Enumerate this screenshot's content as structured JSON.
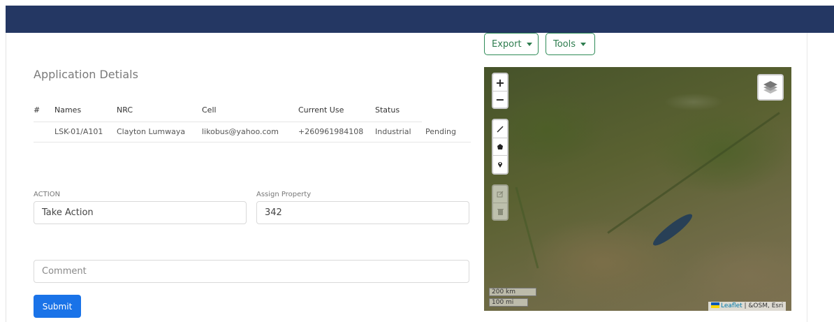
{
  "toolbar": {
    "export_label": "Export",
    "tools_label": "Tools"
  },
  "section": {
    "title": "Application Detials"
  },
  "table": {
    "headers": [
      "#",
      "Names",
      "NRC",
      "Cell",
      "Current Use",
      "Status"
    ],
    "rows": [
      [
        "",
        "LSK-01/A101",
        "Clayton Lumwaya",
        "likobus@yahoo.com",
        "+260961984108",
        "Industrial",
        "Pending"
      ]
    ]
  },
  "form": {
    "action_label": "ACTION",
    "action_value": "Take Action",
    "assign_label": "Assign Property",
    "assign_value": "342",
    "comment_placeholder": "Comment",
    "submit_label": "Submit"
  },
  "map": {
    "zoom_in": "+",
    "zoom_out": "−",
    "scale_km": "200 km",
    "scale_mi": "100 mi",
    "attribution_link": "Leaflet",
    "attribution_rest": " | &OSM, Esri"
  },
  "colors": {
    "header_bar": "#243763",
    "outline_button": "#2e8b57",
    "submit_button": "#1a73e8"
  }
}
